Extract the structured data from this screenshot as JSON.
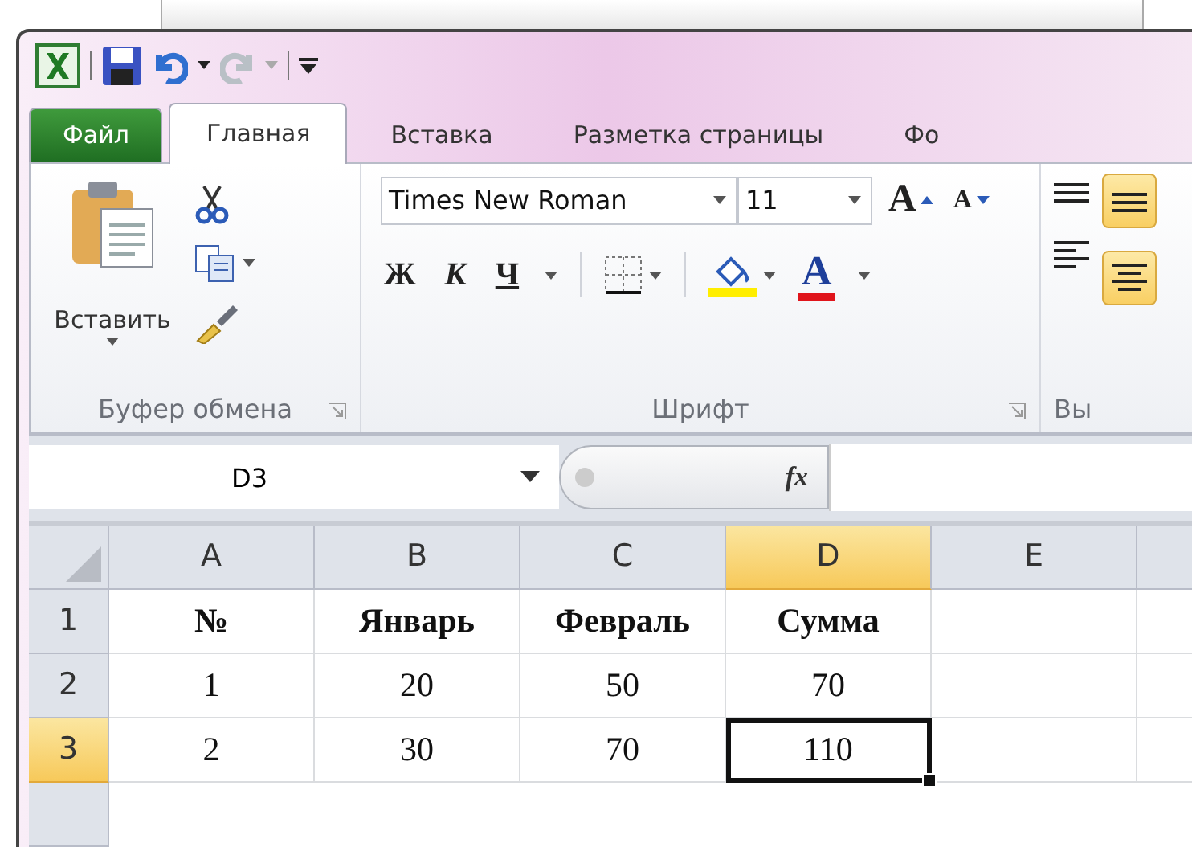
{
  "quick_access": {
    "redo_disabled": true
  },
  "tabs": [
    {
      "label": "Файл",
      "kind": "file",
      "selected": false
    },
    {
      "label": "Главная",
      "kind": "tab",
      "selected": true
    },
    {
      "label": "Вставка",
      "kind": "tab",
      "selected": false
    },
    {
      "label": "Разметка страницы",
      "kind": "tab",
      "selected": false
    },
    {
      "label": "Фо",
      "kind": "tab",
      "selected": false
    }
  ],
  "clipboard": {
    "paste": "Вставить",
    "label": "Буфер обмена"
  },
  "font": {
    "name": "Times New Roman",
    "size": "11",
    "grow": "A",
    "shrink": "A",
    "bold": "Ж",
    "italic": "К",
    "underline": "Ч",
    "color_letter": "A",
    "label": "Шрифт"
  },
  "alignment": {
    "label": "Вы"
  },
  "formula_bar": {
    "name_box": "D3",
    "fx": "fx"
  },
  "sheet": {
    "columns": [
      {
        "label": "A",
        "selected": false
      },
      {
        "label": "B",
        "selected": false
      },
      {
        "label": "C",
        "selected": false
      },
      {
        "label": "D",
        "selected": true
      },
      {
        "label": "E",
        "selected": false
      }
    ],
    "rows": [
      {
        "header": "1",
        "kind": "heading",
        "selected": false,
        "cells": [
          {
            "text": "№",
            "selected": false
          },
          {
            "text": "Январь",
            "selected": false
          },
          {
            "text": "Февраль",
            "selected": false
          },
          {
            "text": "Сумма",
            "selected": false
          }
        ]
      },
      {
        "header": "2",
        "kind": "data",
        "selected": false,
        "cells": [
          {
            "text": "1",
            "selected": false
          },
          {
            "text": "20",
            "selected": false
          },
          {
            "text": "50",
            "selected": false
          },
          {
            "text": "70",
            "selected": false
          }
        ]
      },
      {
        "header": "3",
        "kind": "data",
        "selected": true,
        "cells": [
          {
            "text": "2",
            "selected": false
          },
          {
            "text": "30",
            "selected": false
          },
          {
            "text": "70",
            "selected": false
          },
          {
            "text": "110",
            "selected": true
          }
        ]
      }
    ]
  }
}
